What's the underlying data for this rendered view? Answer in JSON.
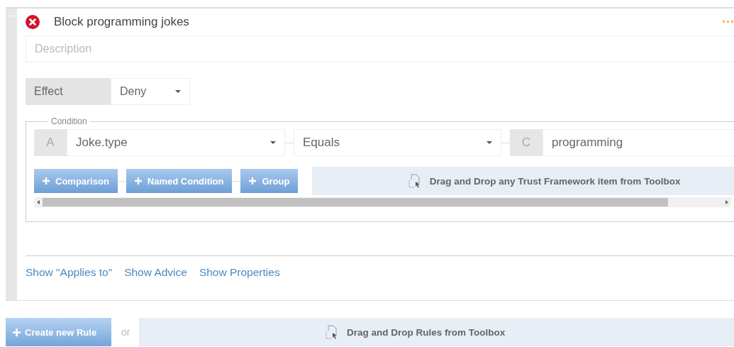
{
  "rule": {
    "title": "Block programming jokes",
    "description": {
      "placeholder": "Description"
    },
    "effect": {
      "label": "Effect",
      "value": "Deny"
    },
    "condition": {
      "legend": "Condition",
      "left": {
        "letter": "A",
        "value": "Joke.type"
      },
      "operator": "Equals",
      "right": {
        "letter": "C",
        "value": "programming"
      },
      "add_buttons": [
        "Comparison",
        "Named Condition",
        "Group"
      ],
      "drop_hint": "Drag and Drop any Trust Framework item from Toolbox"
    },
    "links": [
      "Show \"Applies to\"",
      "Show Advice",
      "Show Properties"
    ]
  },
  "footer": {
    "create_button": "Create new Rule",
    "or": "or",
    "drop_hint": "Drag and Drop Rules from Toolbox"
  }
}
